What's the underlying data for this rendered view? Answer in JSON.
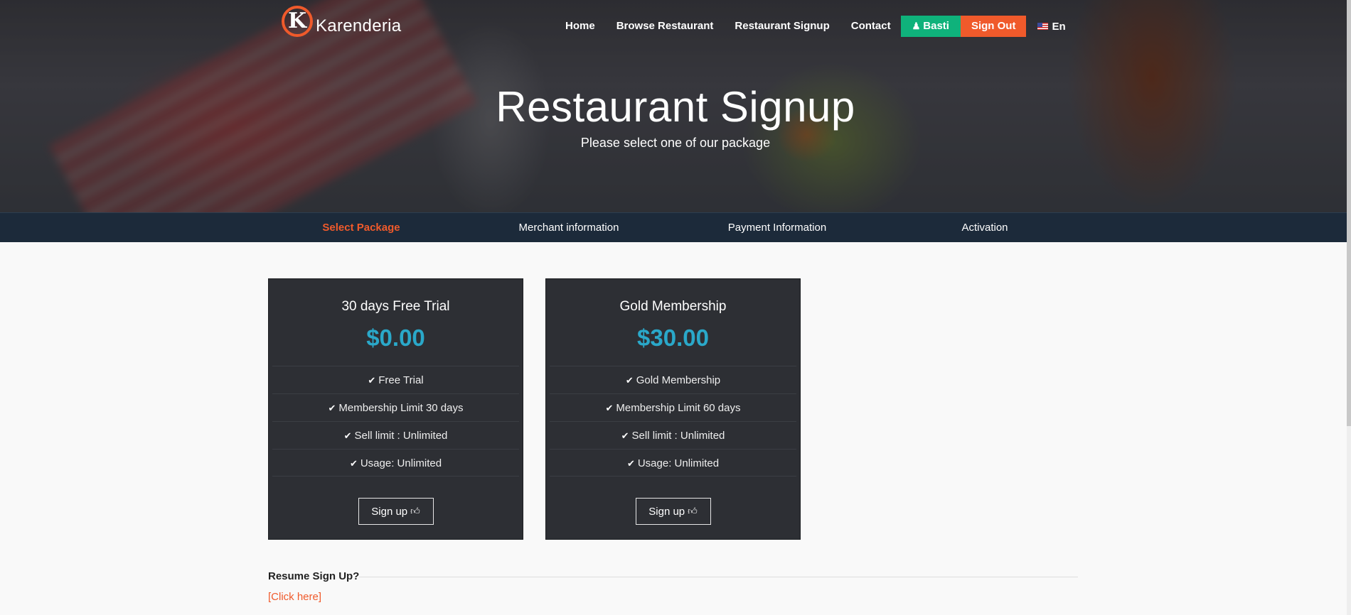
{
  "brand": {
    "logo_letter": "K",
    "name": "Karenderia",
    "accent": "#f05a2b"
  },
  "nav": {
    "links": [
      "Home",
      "Browse Restaurant",
      "Restaurant Signup",
      "Contact"
    ],
    "user_label": "Basti",
    "signout_label": "Sign Out",
    "language": "En"
  },
  "hero": {
    "title": "Restaurant Signup",
    "subtitle": "Please select one of our package"
  },
  "steps": [
    {
      "label": "Select Package",
      "active": true
    },
    {
      "label": "Merchant information",
      "active": false
    },
    {
      "label": "Payment Information",
      "active": false
    },
    {
      "label": "Activation",
      "active": false
    }
  ],
  "plans": [
    {
      "title": "30 days Free Trial",
      "price": "$0.00",
      "features": [
        "Free Trial",
        "Membership Limit 30 days",
        "Sell limit : Unlimited",
        "Usage: Unlimited"
      ],
      "button": "Sign up"
    },
    {
      "title": "Gold Membership",
      "price": "$30.00",
      "features": [
        "Gold Membership",
        "Membership Limit 60 days",
        "Sell limit : Unlimited",
        "Usage: Unlimited"
      ],
      "button": "Sign up"
    }
  ],
  "resume": {
    "title": "Resume Sign Up?",
    "link": "[Click here]"
  },
  "colors": {
    "price": "#2aa8c9",
    "user_button": "#0fb27b",
    "signout_button": "#f05a2b",
    "steps_bar": "#1c2a3a",
    "plan_card": "#2d2f34"
  },
  "icons": {
    "user": "user-icon",
    "check": "check-icon",
    "thumb": "thumbs-up-icon",
    "flag": "us-flag-icon"
  }
}
